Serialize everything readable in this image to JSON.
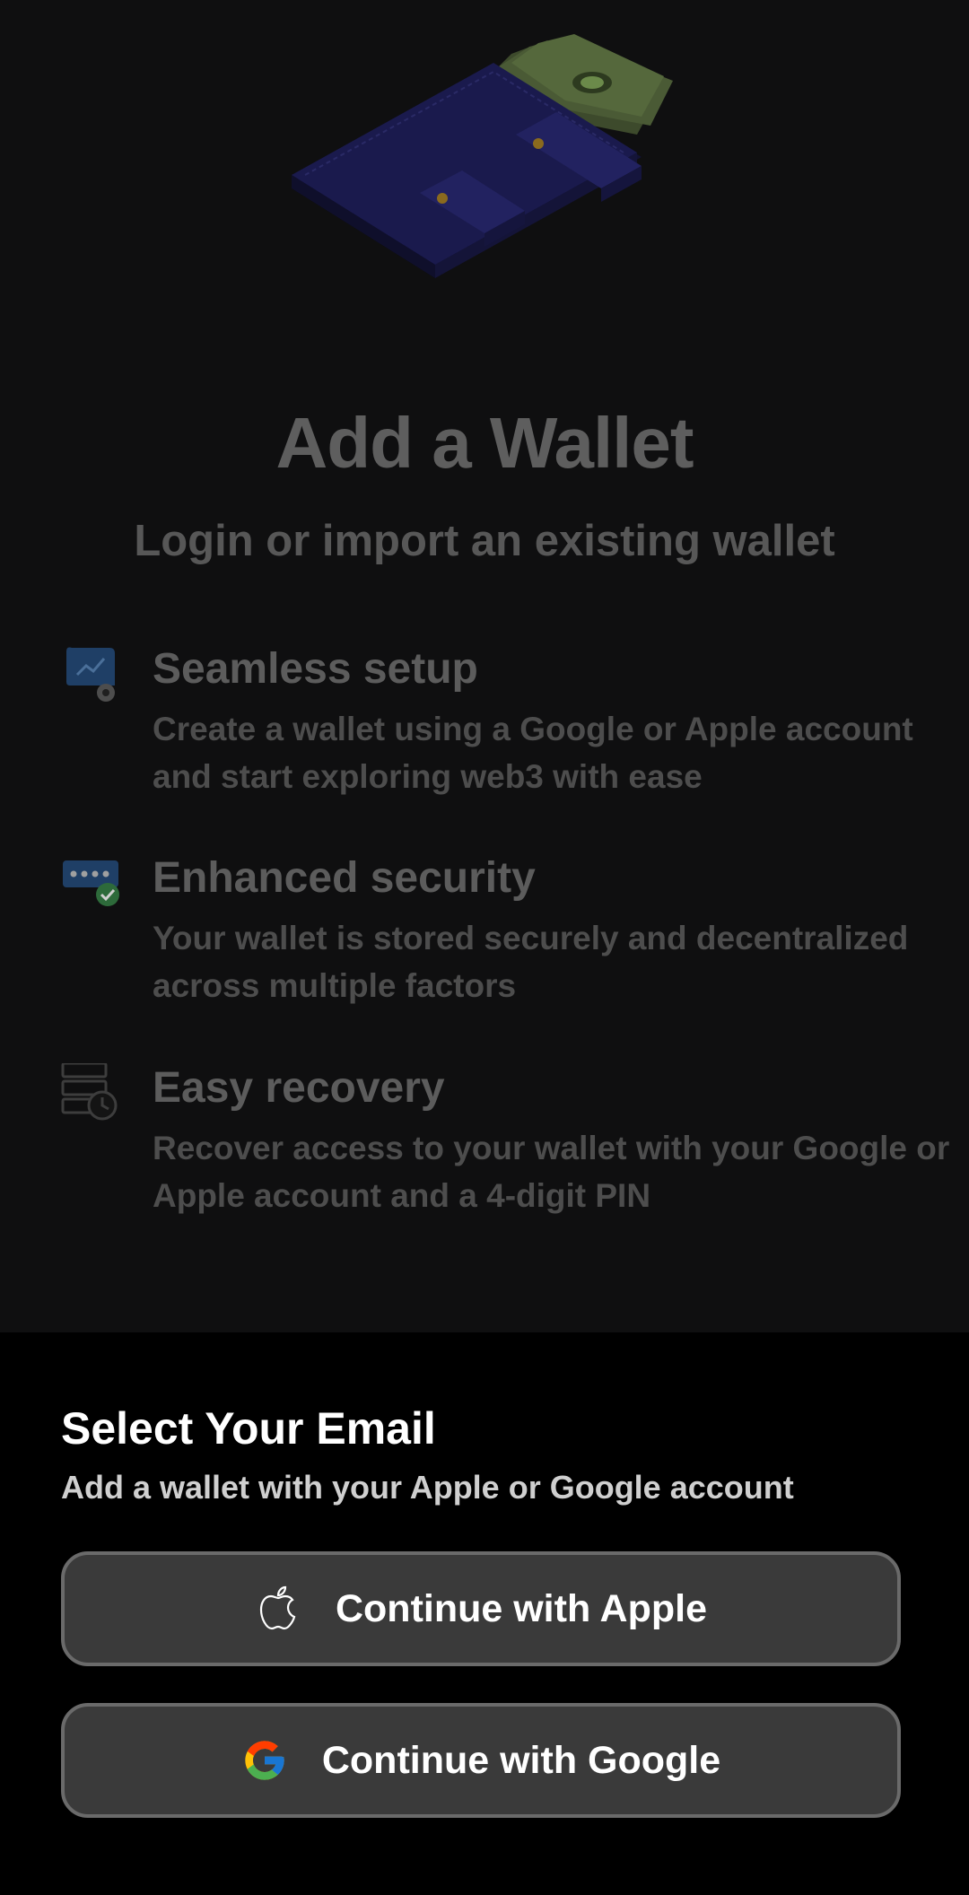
{
  "header": {
    "title": "Add a Wallet",
    "subtitle": "Login or import an existing wallet"
  },
  "features": [
    {
      "icon": "setup-chart-gear-icon",
      "title": "Seamless setup",
      "description": "Create a wallet using a Google or Apple account and start exploring web3 with ease"
    },
    {
      "icon": "password-shield-check-icon",
      "title": "Enhanced security",
      "description": "Your wallet is stored securely and decentralized across multiple factors"
    },
    {
      "icon": "server-recovery-icon",
      "title": "Easy recovery",
      "description": "Recover access to your wallet with your Google or Apple account and a 4-digit PIN"
    }
  ],
  "sheet": {
    "title": "Select Your Email",
    "subtitle": "Add a wallet with your Apple or Google account",
    "buttons": {
      "apple": {
        "label": "Continue with Apple",
        "icon": "apple-logo-icon"
      },
      "google": {
        "label": "Continue with Google",
        "icon": "google-logo-icon"
      }
    }
  },
  "colors": {
    "background": "#0f0f10",
    "sheet_background": "#000000",
    "button_background": "#3a3a3a",
    "button_border": "#6a6a6a",
    "wallet_blue": "#1a1a4d"
  }
}
